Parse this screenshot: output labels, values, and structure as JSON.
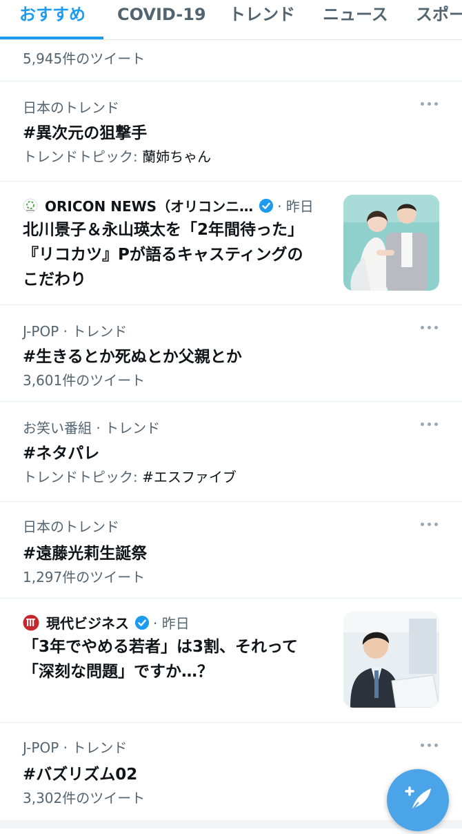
{
  "tabs": [
    {
      "label": "おすすめ",
      "active": true
    },
    {
      "label": "COVID-19"
    },
    {
      "label": "トレンド"
    },
    {
      "label": "ニュース"
    },
    {
      "label": "スポー"
    }
  ],
  "rows": [
    {
      "count": "5,945件のツイート"
    },
    {
      "meta": "日本のトレンド",
      "title": "#異次元の狙撃手",
      "topic_label": "トレンドトピック: ",
      "topic_value": "蘭姉ちゃん"
    },
    {
      "meta": "J-POP · トレンド",
      "title": "#生きるとか死ぬとか父親とか",
      "count": "3,601件のツイート"
    },
    {
      "meta": "お笑い番組 · トレンド",
      "title": "#ネタパレ",
      "topic_label": "トレンドトピック: ",
      "topic_value": "#エスファイブ"
    },
    {
      "meta": "日本のトレンド",
      "title": "#遠藤光莉生誕祭",
      "count": "1,297件のツイート"
    },
    {
      "meta": "J-POP · トレンド",
      "title": "#バズリズム02",
      "count": "3,302件のツイート"
    }
  ],
  "news": [
    {
      "source": "ORICON NEWS（オリコンニ…",
      "time": " · 昨日",
      "line1": "北川景子＆永山瑛太を「2年間待った」",
      "line2": "『リコカツ』Pが語るキャスティングの",
      "line3": "こだわり",
      "thumb_icon": "wedding-photo"
    },
    {
      "source": "現代ビジネス",
      "time": " · 昨日",
      "line1": "「3年でやめる若者」は3割、それって",
      "line2": "「深刻な問題」ですか…？",
      "thumb_icon": "businessman-photo"
    }
  ],
  "colors": {
    "accent": "#1d9bf0",
    "verified": "#1d9bf0",
    "fab": "#4ba3e8"
  }
}
